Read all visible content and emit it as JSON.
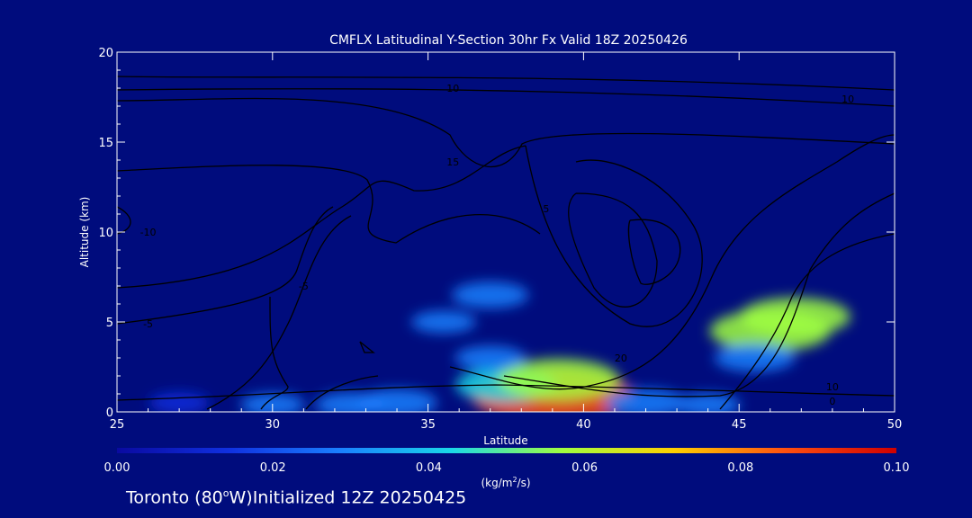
{
  "chart_data": {
    "type": "heatmap",
    "title": "CMFLX Latitudinal Y-Section 30hr  Fx Valid 18Z 20250426",
    "xlabel": "Latitude",
    "ylabel": "Altitude (km)",
    "xlim": [
      25,
      50
    ],
    "ylim": [
      0,
      20
    ],
    "x_ticks": [
      "25",
      "30",
      "35",
      "40",
      "45",
      "50"
    ],
    "y_ticks": [
      "0",
      "5",
      "10",
      "15",
      "20"
    ],
    "x_tick_values": [
      25,
      30,
      35,
      40,
      45,
      50
    ],
    "y_tick_values": [
      0,
      5,
      10,
      15,
      20
    ],
    "colorbar": {
      "min": 0.0,
      "max": 0.1,
      "ticks": [
        "0.00",
        "0.02",
        "0.04",
        "0.06",
        "0.08",
        "0.10"
      ],
      "tick_values": [
        0.0,
        0.02,
        0.04,
        0.06,
        0.08,
        0.1
      ],
      "unit_label": "(kg/m",
      "unit_sup": "2",
      "unit_tail": "/s)",
      "colors": [
        "#0a0aa0",
        "#1030e0",
        "#1a80ff",
        "#1ad8e8",
        "#a0ff40",
        "#ffd000",
        "#ff5010",
        "#d00000"
      ]
    },
    "flux_blobs": [
      {
        "x": 39.0,
        "y": 0.9,
        "value": 0.06
      },
      {
        "x": 37.5,
        "y": 1.5,
        "value": 0.03
      },
      {
        "x": 39.2,
        "y": 1.8,
        "value": 0.04
      },
      {
        "x": 37.0,
        "y": 3.0,
        "value": 0.015
      },
      {
        "x": 37.0,
        "y": 6.5,
        "value": 0.018
      },
      {
        "x": 35.5,
        "y": 5.0,
        "value": 0.012
      },
      {
        "x": 34.0,
        "y": 0.5,
        "value": 0.02
      },
      {
        "x": 32.5,
        "y": 0.4,
        "value": 0.015
      },
      {
        "x": 30.0,
        "y": 0.4,
        "value": 0.012
      },
      {
        "x": 27.0,
        "y": 0.5,
        "value": 0.01
      },
      {
        "x": 42.0,
        "y": 0.5,
        "value": 0.02
      },
      {
        "x": 44.0,
        "y": 0.4,
        "value": 0.012
      },
      {
        "x": 46.0,
        "y": 4.5,
        "value": 0.04
      },
      {
        "x": 46.8,
        "y": 5.3,
        "value": 0.035
      },
      {
        "x": 45.5,
        "y": 3.0,
        "value": 0.02
      }
    ],
    "contour_labels": [
      {
        "x": 31.0,
        "y": 7.0,
        "text": "-5"
      },
      {
        "x": 26.0,
        "y": 10.0,
        "text": "-10"
      },
      {
        "x": 26.0,
        "y": 4.9,
        "text": "-5"
      },
      {
        "x": 35.8,
        "y": 18.0,
        "text": "10"
      },
      {
        "x": 48.5,
        "y": 17.4,
        "text": "10"
      },
      {
        "x": 35.8,
        "y": 13.9,
        "text": "15"
      },
      {
        "x": 38.8,
        "y": 11.3,
        "text": "5"
      },
      {
        "x": 41.2,
        "y": 3.0,
        "text": "20"
      },
      {
        "x": 48.0,
        "y": 1.4,
        "text": "10"
      },
      {
        "x": 48.0,
        "y": 0.6,
        "text": "0"
      }
    ]
  },
  "footer": {
    "prefix": "Toronto (80",
    "degree": "o",
    "suffix": "W)Initialized 12Z 20250425"
  }
}
